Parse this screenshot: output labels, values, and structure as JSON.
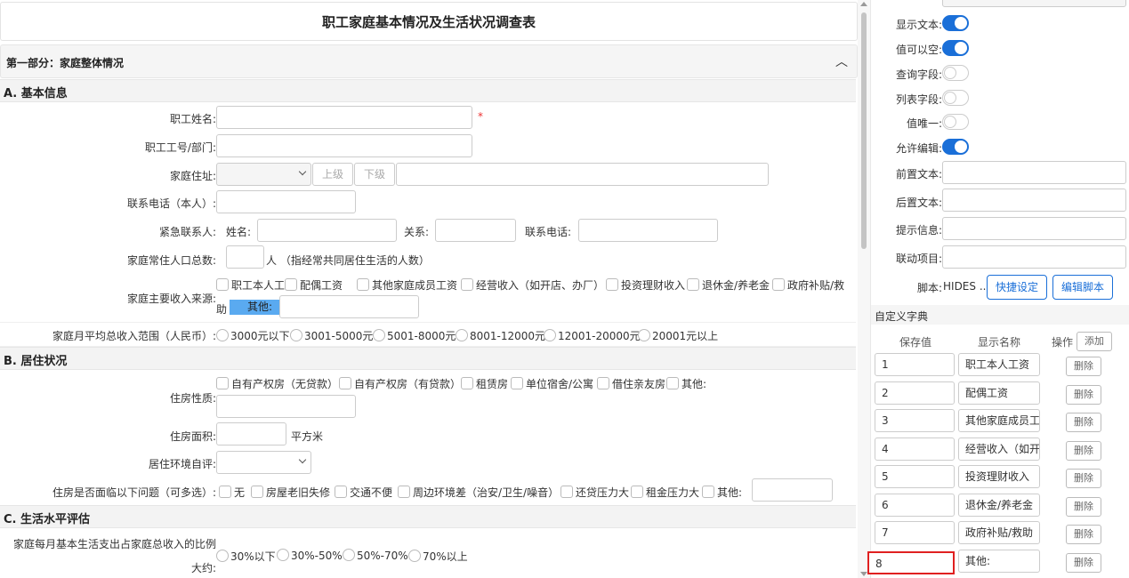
{
  "form": {
    "title": "职工家庭基本情况及生活状况调查表",
    "part1_title": "第一部分：家庭整体情况",
    "sections": {
      "a": "A. 基本信息",
      "b": "B. 居住状况",
      "c": "C. 生活水平评估"
    },
    "fields": {
      "name_label": "职工姓名:",
      "required_mark": "*",
      "id_dept_label": "职工工号/部门:",
      "address_label": "家庭住址:",
      "address_up": "上级",
      "address_down": "下级",
      "phone_label": "联系电话（本人）:",
      "emergency_label": "紧急联系人:",
      "emergency_name": "姓名:",
      "emergency_relation": "关系:",
      "emergency_phone": "联系电话:",
      "population_label": "家庭常住人口总数:",
      "population_suffix": "人 （指经常共同居住生活的人数）",
      "income_source_label": "家庭主要收入来源:",
      "income_sources": [
        "职工本人工资",
        "配偶工资",
        "其他家庭成员工资",
        "经营收入（如开店、办厂）",
        "投资理财收入",
        "退休金/养老金",
        "政府补贴/救"
      ],
      "income_sources_wrap": "助",
      "income_other": "其他:",
      "income_range_label": "家庭月平均总收入范围（人民币）:",
      "income_ranges": [
        "3000元以下",
        "3001-5000元",
        "5001-8000元",
        "8001-12000元",
        "12001-20000元",
        "20001元以上"
      ],
      "housing_type_label": "住房性质:",
      "housing_types": [
        "自有产权房（无贷款）",
        "自有产权房（有贷款）",
        "租赁房",
        "单位宿舍/公寓",
        "借住亲友房",
        "其他:"
      ],
      "area_label": "住房面积:",
      "area_unit": "平方米",
      "env_label": "居住环境自评:",
      "issues_label": "住房是否面临以下问题（可多选）:",
      "issues": [
        "无",
        "房屋老旧失修",
        "交通不便",
        "周边环境差（治安/卫生/噪音）",
        "还贷压力大",
        "租金压力大",
        "其他:"
      ],
      "expense_label_1": "家庭每月基本生活支出占家庭总收入的比例",
      "expense_label_2": "大约:",
      "expense_options": [
        "30%以下",
        "30%-50%",
        "50%-70%",
        "70%以上"
      ]
    }
  },
  "panel": {
    "toggles": [
      {
        "label": "显示文本:",
        "on": true
      },
      {
        "label": "值可以空:",
        "on": true
      },
      {
        "label": "查询字段:",
        "on": false
      },
      {
        "label": "列表字段:",
        "on": false
      },
      {
        "label": "值唯一:",
        "on": false
      },
      {
        "label": "允许编辑:",
        "on": true
      }
    ],
    "prefix_label": "前置文本:",
    "suffix_label": "后置文本:",
    "hint_label": "提示信息:",
    "linkage_label": "联动项目:",
    "script_label": "脚本:",
    "script_value": "HIDES ...",
    "quick_btn": "快捷设定",
    "edit_script_btn": "编辑脚本",
    "dict_title": "自定义字典",
    "col_value": "保存值",
    "col_name": "显示名称",
    "col_op": "操作",
    "add_btn": "添加",
    "delete_btn": "删除",
    "dict": [
      {
        "value": "1",
        "name": "职工本人工资"
      },
      {
        "value": "2",
        "name": "配偶工资"
      },
      {
        "value": "3",
        "name": "其他家庭成员工"
      },
      {
        "value": "4",
        "name": "经营收入（如开"
      },
      {
        "value": "5",
        "name": "投资理财收入"
      },
      {
        "value": "6",
        "name": "退休金/养老金"
      },
      {
        "value": "7",
        "name": "政府补贴/救助"
      },
      {
        "value": "8",
        "name": "其他:"
      }
    ],
    "selected_color": "#e02020",
    "accent": "#1a6fd8"
  }
}
